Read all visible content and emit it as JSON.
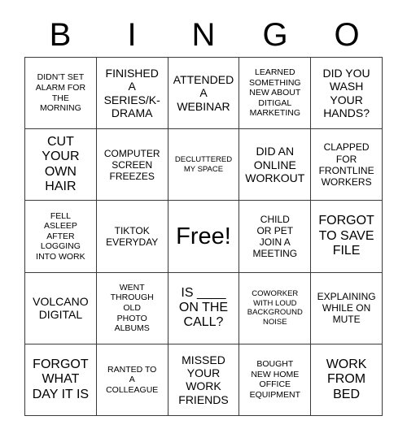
{
  "card": {
    "header_letters": [
      "B",
      "I",
      "N",
      "G",
      "O"
    ],
    "free_space_label": "Free!",
    "rows": [
      [
        {
          "text": "DIDN’T SET\nALARM FOR\nTHE\nMORNING",
          "size": "sm"
        },
        {
          "text": "FINISHED\nA\nSERIES/K-\nDRAMA",
          "size": "lg"
        },
        {
          "text": "ATTENDED\nA\nWEBINAR",
          "size": "lg"
        },
        {
          "text": "LEARNED\nSOMETHING\nNEW ABOUT\nDITIGAL\nMARKETING",
          "size": "sm"
        },
        {
          "text": "DID YOU\nWASH\nYOUR\nHANDS?",
          "size": "lg"
        }
      ],
      [
        {
          "text": "CUT\nYOUR\nOWN\nHAIR",
          "size": "xl"
        },
        {
          "text": "COMPUTER\nSCREEN\nFREEZES",
          "size": "md"
        },
        {
          "text": "DECLUTTERED\nMY SPACE",
          "size": "xs"
        },
        {
          "text": "DID AN\nONLINE\nWORKOUT",
          "size": "lg"
        },
        {
          "text": "CLAPPED\nFOR\nFRONTLINE\nWORKERS",
          "size": "md"
        }
      ],
      [
        {
          "text": "FELL\nASLEEP\nAFTER\nLOGGING\nINTO WORK",
          "size": "sm"
        },
        {
          "text": "TIKTOK\nEVERYDAY",
          "size": "md"
        },
        {
          "text": "Free!",
          "size": "free",
          "is_free": true
        },
        {
          "text": "CHILD\nOR PET\nJOIN A\nMEETING",
          "size": "md"
        },
        {
          "text": "FORGOT\nTO SAVE\nFILE",
          "size": "xl"
        }
      ],
      [
        {
          "text": "VOLCANO\nDIGITAL",
          "size": "lg"
        },
        {
          "text": "WENT\nTHROUGH\nOLD\nPHOTO\nALBUMS",
          "size": "sm"
        },
        {
          "text": "IS ____\nON THE\nCALL?",
          "size": "xl"
        },
        {
          "text": "COWORKER\nWITH LOUD\nBACKGROUND\nNOISE",
          "size": "xs"
        },
        {
          "text": "EXPLAINING\nWHILE ON\nMUTE",
          "size": "md"
        }
      ],
      [
        {
          "text": "FORGOT\nWHAT\nDAY IT IS",
          "size": "xl"
        },
        {
          "text": "RANTED TO\nA\nCOLLEAGUE",
          "size": "sm"
        },
        {
          "text": "MISSED\nYOUR\nWORK\nFRIENDS",
          "size": "lg"
        },
        {
          "text": "BOUGHT\nNEW HOME\nOFFICE\nEQUIPMENT",
          "size": "sm"
        },
        {
          "text": "WORK\nFROM\nBED",
          "size": "xl"
        }
      ]
    ]
  },
  "colors": {
    "background": "#ffffff",
    "text": "#000000",
    "border": "#3a3a3a"
  }
}
